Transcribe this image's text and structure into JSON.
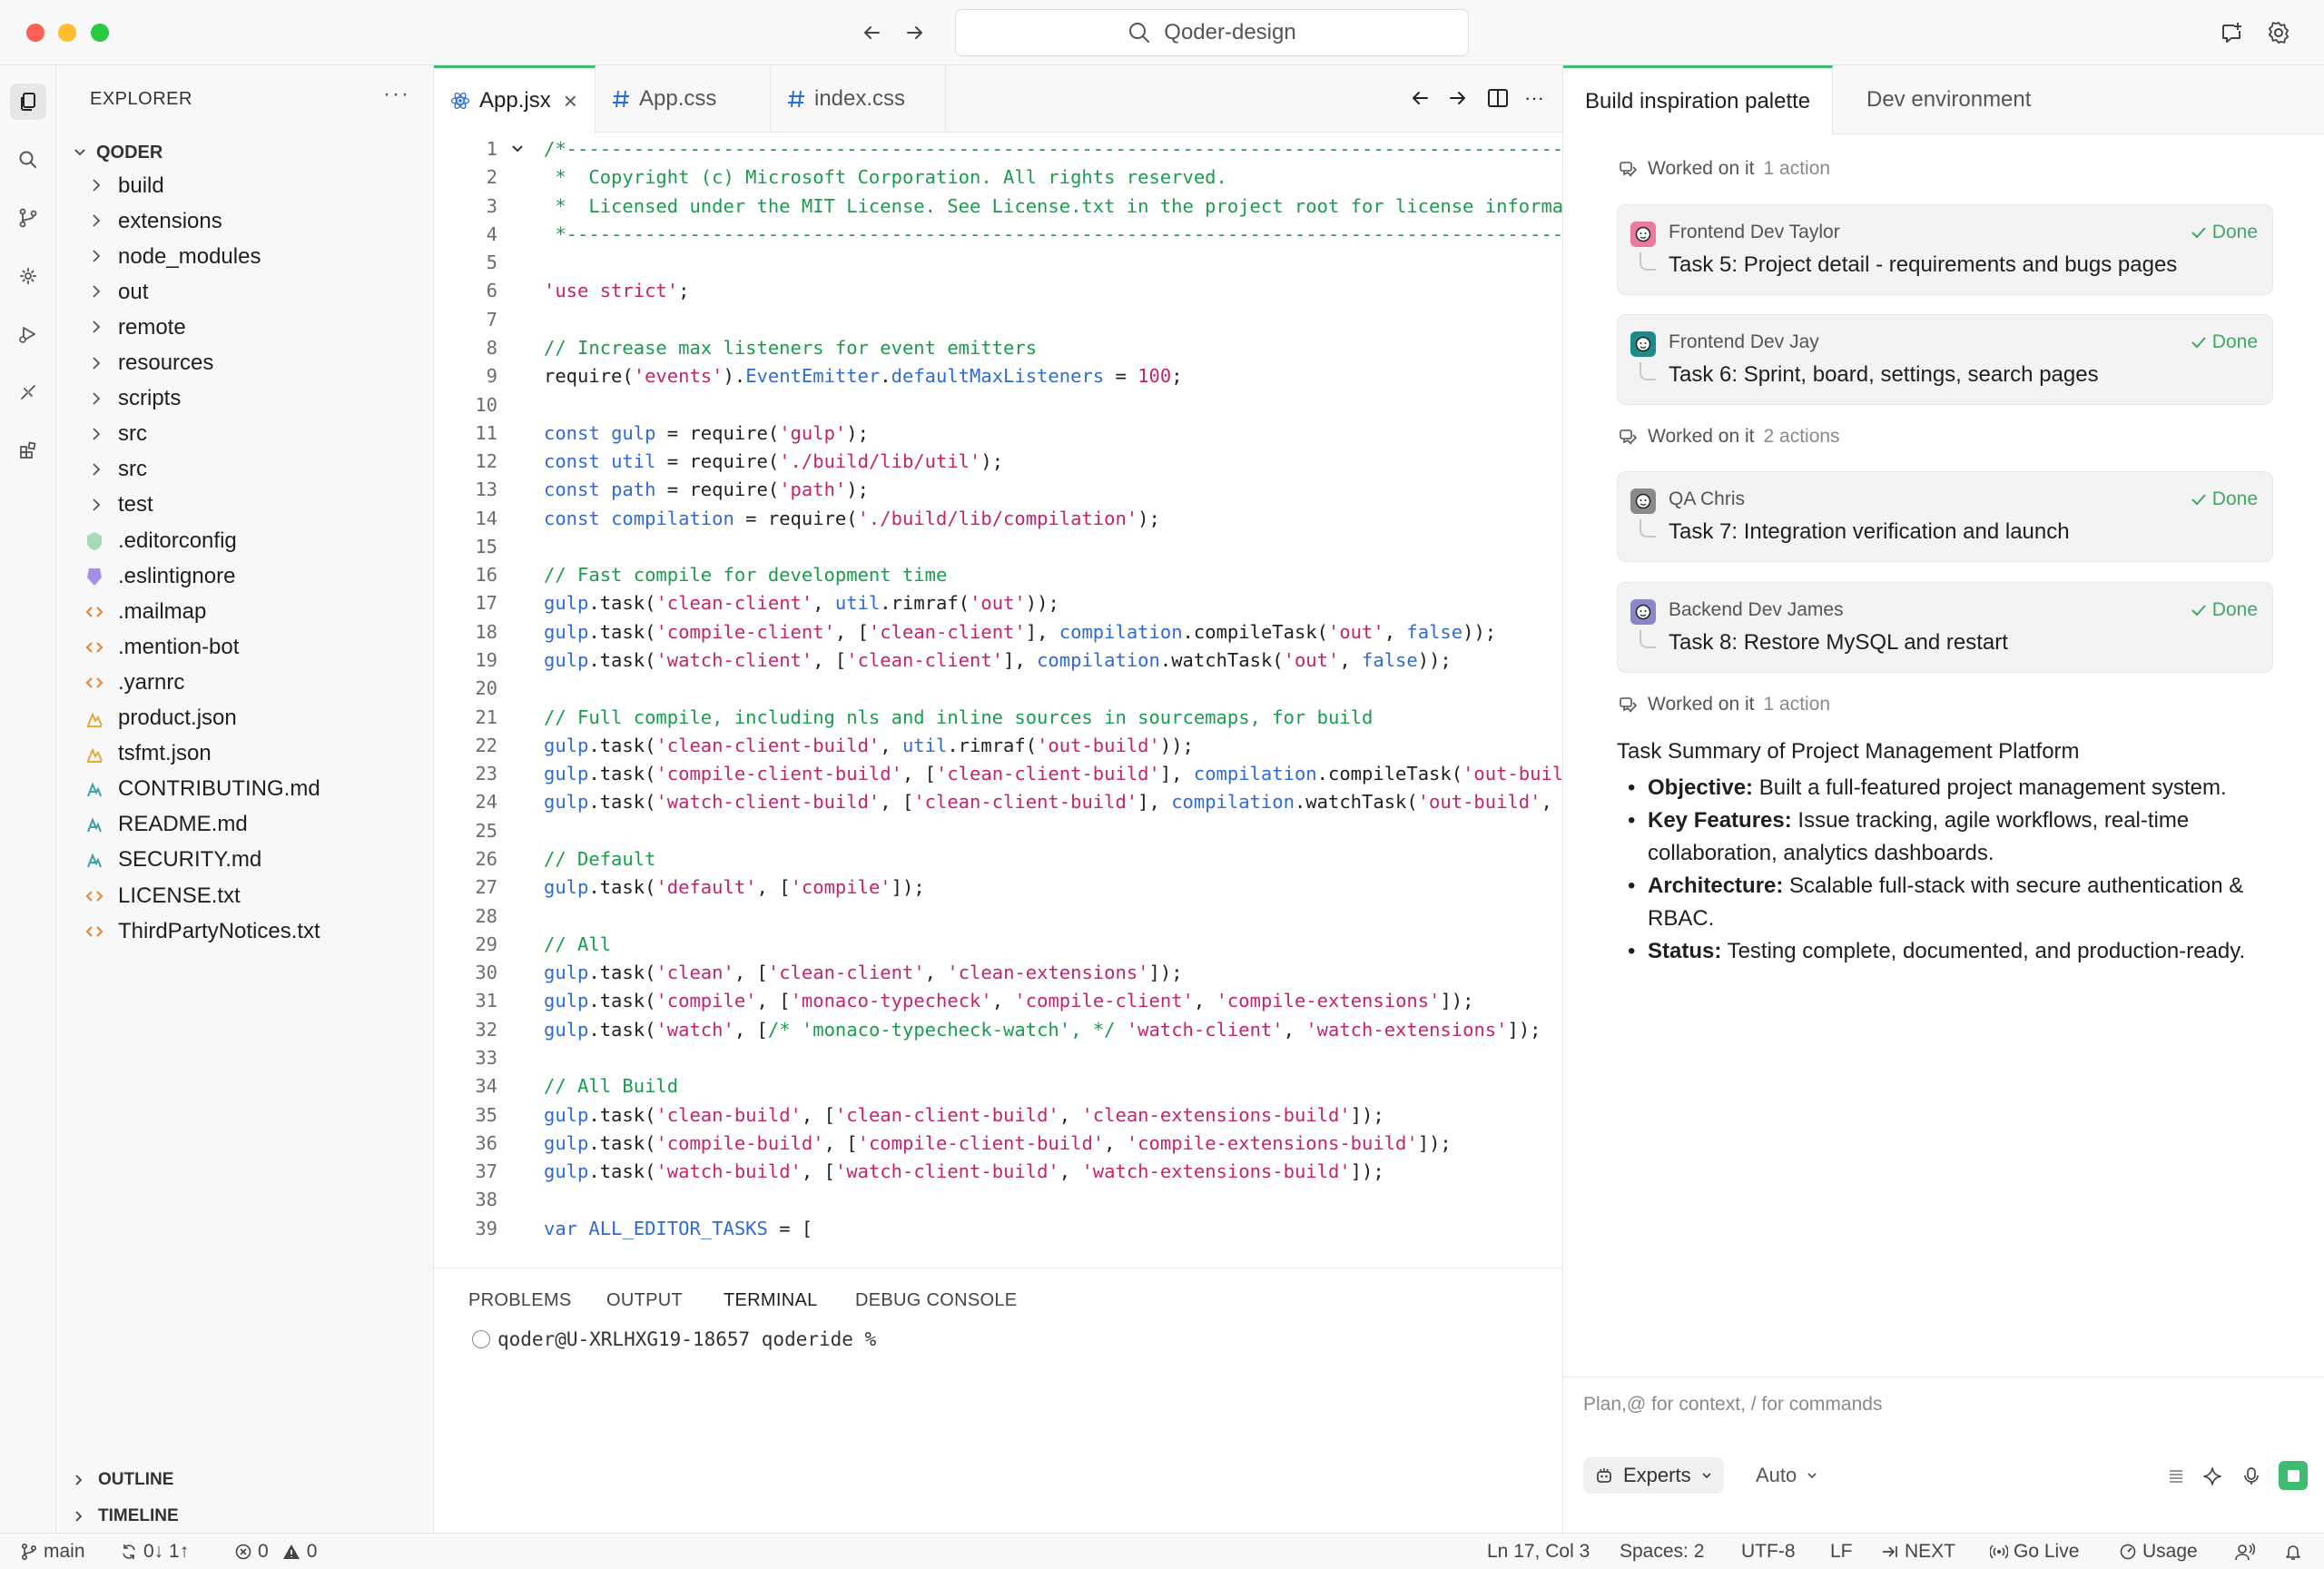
{
  "titlebar": {
    "search_placeholder": "Qoder-design"
  },
  "explorer": {
    "title": "EXPLORER",
    "root": "QODER",
    "items": [
      {
        "label": "build",
        "type": "folder"
      },
      {
        "label": "extensions",
        "type": "folder"
      },
      {
        "label": "node_modules",
        "type": "folder"
      },
      {
        "label": "out",
        "type": "folder"
      },
      {
        "label": "remote",
        "type": "folder"
      },
      {
        "label": "resources",
        "type": "folder"
      },
      {
        "label": "scripts",
        "type": "folder"
      },
      {
        "label": "src",
        "type": "folder"
      },
      {
        "label": "src",
        "type": "folder"
      },
      {
        "label": "test",
        "type": "folder"
      },
      {
        "label": ".editorconfig",
        "type": "editorconfig-icon"
      },
      {
        "label": ".eslintignore",
        "type": "eslint-icon"
      },
      {
        "label": ".mailmap",
        "type": "code-file-icon"
      },
      {
        "label": ".mention-bot",
        "type": "code-file-icon"
      },
      {
        "label": ".yarnrc",
        "type": "code-file-icon"
      },
      {
        "label": "product.json",
        "type": "json-icon"
      },
      {
        "label": "tsfmt.json",
        "type": "json-icon"
      },
      {
        "label": "CONTRIBUTING.md",
        "type": "markdown-icon"
      },
      {
        "label": "README.md",
        "type": "markdown-icon"
      },
      {
        "label": "SECURITY.md",
        "type": "markdown-icon"
      },
      {
        "label": "LICENSE.txt",
        "type": "code-file-icon"
      },
      {
        "label": "ThirdPartyNotices.txt",
        "type": "code-file-icon"
      }
    ],
    "outline": "OUTLINE",
    "timeline": "TIMELINE"
  },
  "editor": {
    "tabs": [
      {
        "label": "App.jsx",
        "icon": "react-icon",
        "active": true
      },
      {
        "label": "App.css",
        "icon": "hash-icon",
        "active": false
      },
      {
        "label": "index.css",
        "icon": "hash-icon",
        "active": false
      }
    ],
    "lines": [
      {
        "n": "1",
        "t": [
          [
            "c-com",
            "/*---------------------------------------------------------------------------------------------"
          ]
        ]
      },
      {
        "n": "2",
        "t": [
          [
            "c-com",
            " *  Copyright (c) Microsoft Corporation. All rights reserved."
          ]
        ]
      },
      {
        "n": "3",
        "t": [
          [
            "c-com",
            " *  Licensed under the MIT License. See License.txt in the project root for license information."
          ]
        ]
      },
      {
        "n": "4",
        "t": [
          [
            "c-com",
            " *--------------------------------------------------------------------------------------------*/"
          ]
        ]
      },
      {
        "n": "5",
        "t": []
      },
      {
        "n": "6",
        "t": [
          [
            "c-str",
            "'use strict'"
          ],
          [
            "",
            ";"
          ]
        ]
      },
      {
        "n": "7",
        "t": []
      },
      {
        "n": "8",
        "t": [
          [
            "c-com",
            "// Increase max listeners for event emitters"
          ]
        ]
      },
      {
        "n": "9",
        "t": [
          [
            "",
            "require("
          ],
          [
            "c-str",
            "'events'"
          ],
          [
            "",
            ")."
          ],
          [
            "c-kw",
            "EventEmitter"
          ],
          [
            "",
            "."
          ],
          [
            "c-kw",
            "defaultMaxListeners"
          ],
          [
            "",
            " = "
          ],
          [
            "c-str",
            "100"
          ],
          [
            "",
            ";"
          ]
        ]
      },
      {
        "n": "10",
        "t": []
      },
      {
        "n": "11",
        "t": [
          [
            "c-kw",
            "const "
          ],
          [
            "c-kw",
            "gulp"
          ],
          [
            "",
            " = require("
          ],
          [
            "c-str",
            "'gulp'"
          ],
          [
            "",
            ");"
          ]
        ]
      },
      {
        "n": "12",
        "t": [
          [
            "c-kw",
            "const "
          ],
          [
            "c-kw",
            "util"
          ],
          [
            "",
            " = require("
          ],
          [
            "c-str",
            "'./build/lib/util'"
          ],
          [
            "",
            ");"
          ]
        ]
      },
      {
        "n": "13",
        "t": [
          [
            "c-kw",
            "const "
          ],
          [
            "c-kw",
            "path"
          ],
          [
            "",
            " = require("
          ],
          [
            "c-str",
            "'path'"
          ],
          [
            "",
            ");"
          ]
        ]
      },
      {
        "n": "14",
        "t": [
          [
            "c-kw",
            "const "
          ],
          [
            "c-kw",
            "compilation"
          ],
          [
            "",
            " = require("
          ],
          [
            "c-str",
            "'./build/lib/compilation'"
          ],
          [
            "",
            ");"
          ]
        ]
      },
      {
        "n": "15",
        "t": []
      },
      {
        "n": "16",
        "t": [
          [
            "c-com",
            "// Fast compile for development time"
          ]
        ]
      },
      {
        "n": "17",
        "t": [
          [
            "c-kw",
            "gulp"
          ],
          [
            "",
            ".task("
          ],
          [
            "c-str",
            "'clean-client'"
          ],
          [
            "",
            ", "
          ],
          [
            "c-kw",
            "util"
          ],
          [
            "",
            ".rimraf("
          ],
          [
            "c-str",
            "'out'"
          ],
          [
            "",
            "));"
          ]
        ]
      },
      {
        "n": "18",
        "t": [
          [
            "c-kw",
            "gulp"
          ],
          [
            "",
            ".task("
          ],
          [
            "c-str",
            "'compile-client'"
          ],
          [
            "",
            ", ["
          ],
          [
            "c-str",
            "'clean-client'"
          ],
          [
            "",
            "], "
          ],
          [
            "c-kw",
            "compilation"
          ],
          [
            "",
            ".compileTask("
          ],
          [
            "c-str",
            "'out'"
          ],
          [
            "",
            ", "
          ],
          [
            "c-kw",
            "false"
          ],
          [
            "",
            "));"
          ]
        ]
      },
      {
        "n": "19",
        "t": [
          [
            "c-kw",
            "gulp"
          ],
          [
            "",
            ".task("
          ],
          [
            "c-str",
            "'watch-client'"
          ],
          [
            "",
            ", ["
          ],
          [
            "c-str",
            "'clean-client'"
          ],
          [
            "",
            "], "
          ],
          [
            "c-kw",
            "compilation"
          ],
          [
            "",
            ".watchTask("
          ],
          [
            "c-str",
            "'out'"
          ],
          [
            "",
            ", "
          ],
          [
            "c-kw",
            "false"
          ],
          [
            "",
            "));"
          ]
        ]
      },
      {
        "n": "20",
        "t": []
      },
      {
        "n": "21",
        "t": [
          [
            "c-com",
            "// Full compile, including nls and inline sources in sourcemaps, for build"
          ]
        ]
      },
      {
        "n": "22",
        "t": [
          [
            "c-kw",
            "gulp"
          ],
          [
            "",
            ".task("
          ],
          [
            "c-str",
            "'clean-client-build'"
          ],
          [
            "",
            ", "
          ],
          [
            "c-kw",
            "util"
          ],
          [
            "",
            ".rimraf("
          ],
          [
            "c-str",
            "'out-build'"
          ],
          [
            "",
            "));"
          ]
        ]
      },
      {
        "n": "23",
        "t": [
          [
            "c-kw",
            "gulp"
          ],
          [
            "",
            ".task("
          ],
          [
            "c-str",
            "'compile-client-build'"
          ],
          [
            "",
            ", ["
          ],
          [
            "c-str",
            "'clean-client-build'"
          ],
          [
            "",
            "], "
          ],
          [
            "c-kw",
            "compilation"
          ],
          [
            "",
            ".compileTask("
          ],
          [
            "c-str",
            "'out-build'"
          ],
          [
            "",
            ", "
          ],
          [
            "c-kw",
            "true"
          ],
          [
            "",
            "));"
          ]
        ]
      },
      {
        "n": "24",
        "t": [
          [
            "c-kw",
            "gulp"
          ],
          [
            "",
            ".task("
          ],
          [
            "c-str",
            "'watch-client-build'"
          ],
          [
            "",
            ", ["
          ],
          [
            "c-str",
            "'clean-client-build'"
          ],
          [
            "",
            "], "
          ],
          [
            "c-kw",
            "compilation"
          ],
          [
            "",
            ".watchTask("
          ],
          [
            "c-str",
            "'out-build'"
          ],
          [
            "",
            ", "
          ],
          [
            "c-kw",
            "true"
          ],
          [
            "",
            "));"
          ]
        ]
      },
      {
        "n": "25",
        "t": []
      },
      {
        "n": "26",
        "t": [
          [
            "c-com",
            "// Default"
          ]
        ]
      },
      {
        "n": "27",
        "t": [
          [
            "c-kw",
            "gulp"
          ],
          [
            "",
            ".task("
          ],
          [
            "c-str",
            "'default'"
          ],
          [
            "",
            ", ["
          ],
          [
            "c-str",
            "'compile'"
          ],
          [
            "",
            "]);"
          ]
        ]
      },
      {
        "n": "28",
        "t": []
      },
      {
        "n": "29",
        "t": [
          [
            "c-com",
            "// All"
          ]
        ]
      },
      {
        "n": "30",
        "t": [
          [
            "c-kw",
            "gulp"
          ],
          [
            "",
            ".task("
          ],
          [
            "c-str",
            "'clean'"
          ],
          [
            "",
            ", ["
          ],
          [
            "c-str",
            "'clean-client'"
          ],
          [
            "",
            ", "
          ],
          [
            "c-str",
            "'clean-extensions'"
          ],
          [
            "",
            "]);"
          ]
        ]
      },
      {
        "n": "31",
        "t": [
          [
            "c-kw",
            "gulp"
          ],
          [
            "",
            ".task("
          ],
          [
            "c-str",
            "'compile'"
          ],
          [
            "",
            ", ["
          ],
          [
            "c-str",
            "'monaco-typecheck'"
          ],
          [
            "",
            ", "
          ],
          [
            "c-str",
            "'compile-client'"
          ],
          [
            "",
            ", "
          ],
          [
            "c-str",
            "'compile-extensions'"
          ],
          [
            "",
            "]);"
          ]
        ]
      },
      {
        "n": "32",
        "t": [
          [
            "c-kw",
            "gulp"
          ],
          [
            "",
            ".task("
          ],
          [
            "c-str",
            "'watch'"
          ],
          [
            "",
            ", ["
          ],
          [
            "c-com",
            "/* 'monaco-typecheck-watch', */"
          ],
          [
            "",
            " "
          ],
          [
            "c-str",
            "'watch-client'"
          ],
          [
            "",
            ", "
          ],
          [
            "c-str",
            "'watch-extensions'"
          ],
          [
            "",
            "]);"
          ]
        ]
      },
      {
        "n": "33",
        "t": []
      },
      {
        "n": "34",
        "t": [
          [
            "c-com",
            "// All Build"
          ]
        ]
      },
      {
        "n": "35",
        "t": [
          [
            "c-kw",
            "gulp"
          ],
          [
            "",
            ".task("
          ],
          [
            "c-str",
            "'clean-build'"
          ],
          [
            "",
            ", ["
          ],
          [
            "c-str",
            "'clean-client-build'"
          ],
          [
            "",
            ", "
          ],
          [
            "c-str",
            "'clean-extensions-build'"
          ],
          [
            "",
            "]);"
          ]
        ]
      },
      {
        "n": "36",
        "t": [
          [
            "c-kw",
            "gulp"
          ],
          [
            "",
            ".task("
          ],
          [
            "c-str",
            "'compile-build'"
          ],
          [
            "",
            ", ["
          ],
          [
            "c-str",
            "'compile-client-build'"
          ],
          [
            "",
            ", "
          ],
          [
            "c-str",
            "'compile-extensions-build'"
          ],
          [
            "",
            "]);"
          ]
        ]
      },
      {
        "n": "37",
        "t": [
          [
            "c-kw",
            "gulp"
          ],
          [
            "",
            ".task("
          ],
          [
            "c-str",
            "'watch-build'"
          ],
          [
            "",
            ", ["
          ],
          [
            "c-str",
            "'watch-client-build'"
          ],
          [
            "",
            ", "
          ],
          [
            "c-str",
            "'watch-extensions-build'"
          ],
          [
            "",
            "]);"
          ]
        ]
      },
      {
        "n": "38",
        "t": []
      },
      {
        "n": "39",
        "t": [
          [
            "c-kw",
            "var "
          ],
          [
            "c-kw",
            "ALL_EDITOR_TASKS"
          ],
          [
            "",
            " = ["
          ]
        ]
      }
    ]
  },
  "panel": {
    "tabs": [
      {
        "label": "PROBLEMS",
        "active": false
      },
      {
        "label": "OUTPUT",
        "active": false
      },
      {
        "label": "TERMINAL",
        "active": true
      },
      {
        "label": "DEBUG CONSOLE",
        "active": false
      }
    ],
    "terminal_prompt": "qoder@U-XRLHXG19-18657 qoderide %"
  },
  "right_pane": {
    "tabs": [
      {
        "label": "Build inspiration palette",
        "active": true
      },
      {
        "label": "Dev environment",
        "active": false
      }
    ],
    "worked_label": "Worked on it",
    "groups": [
      {
        "count": "1 action"
      },
      {
        "count": "2 actions"
      },
      {
        "count": "1 action"
      }
    ],
    "tasks": [
      {
        "agent": "Frontend Dev Taylor",
        "status": "Done",
        "title": "Task 5: Project detail - requirements and bugs pages",
        "color": "#e87aa0"
      },
      {
        "agent": "Frontend Dev Jay",
        "status": "Done",
        "title": "Task 6: Sprint, board, settings, search pages",
        "color": "#1f8a8a"
      },
      {
        "agent": "QA Chris",
        "status": "Done",
        "title": "Task 7: Integration verification and launch",
        "color": "#8a8a8a"
      },
      {
        "agent": "Backend Dev James",
        "status": "Done",
        "title": "Task 8: Restore MySQL and restart",
        "color": "#8a86c8"
      }
    ],
    "summary": {
      "title": "Task Summary of Project Management Platform",
      "items": [
        {
          "label": "Objective:",
          "text": " Built a full-featured project management system."
        },
        {
          "label": "Key Features:",
          "text": " Issue tracking, agile workflows, real-time collaboration, analytics dashboards."
        },
        {
          "label": "Architecture:",
          "text": " Scalable full-stack with secure authentication & RBAC."
        },
        {
          "label": "Status:",
          "text": " Testing complete, documented, and production-ready."
        }
      ]
    },
    "chat": {
      "placeholder": "Plan,@ for context, / for commands",
      "experts_label": "Experts",
      "mode_label": "Auto"
    }
  },
  "statusbar": {
    "branch": "main",
    "sync": "0↓ 1↑",
    "errors": "0",
    "warnings": "0",
    "cursor": "Ln 17, Col 3",
    "spaces": "Spaces: 2",
    "encoding": "UTF-8",
    "eol": "LF",
    "next": "NEXT",
    "golive": "Go Live",
    "usage": "Usage"
  },
  "colors": {
    "accent": "#3fbb72",
    "comment": "#1a9c4f",
    "string": "#c4246b",
    "keyword": "#2f6bd4"
  }
}
